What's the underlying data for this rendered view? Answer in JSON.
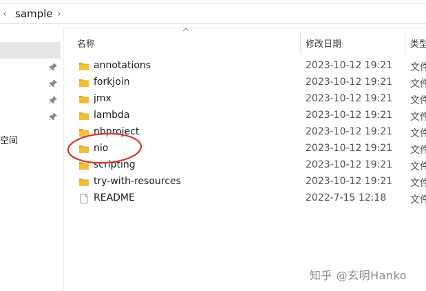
{
  "address_bar": {
    "crumb": "sample",
    "separator_left": "‹",
    "separator_right": "›"
  },
  "nav_pane": {
    "partial_label": "空间",
    "pinned_items": 4
  },
  "columns": {
    "name": "名称",
    "date_modified": "修改日期",
    "type": "类型"
  },
  "files": [
    {
      "name": "annotations",
      "date": "2023-10-12 19:21",
      "type": "文件",
      "kind": "folder"
    },
    {
      "name": "forkjoin",
      "date": "2023-10-12 19:21",
      "type": "文件",
      "kind": "folder"
    },
    {
      "name": "jmx",
      "date": "2023-10-12 19:21",
      "type": "文件",
      "kind": "folder"
    },
    {
      "name": "lambda",
      "date": "2023-10-12 19:21",
      "type": "文件",
      "kind": "folder"
    },
    {
      "name": "nbproject",
      "date": "2023-10-12 19:21",
      "type": "文件",
      "kind": "folder"
    },
    {
      "name": "nio",
      "date": "2023-10-12 19:21",
      "type": "文件",
      "kind": "folder"
    },
    {
      "name": "scripting",
      "date": "2023-10-12 19:21",
      "type": "文件",
      "kind": "folder"
    },
    {
      "name": "try-with-resources",
      "date": "2023-10-12 19:21",
      "type": "文件",
      "kind": "folder"
    },
    {
      "name": "README",
      "date": "2022-7-15 12:18",
      "type": "文件",
      "kind": "file"
    }
  ],
  "annotation": {
    "target": "nio",
    "color": "#d9322a"
  },
  "watermark": "知乎 @玄明Hanko",
  "colors": {
    "folder": "#f2c037",
    "folder_dark": "#e0a520",
    "selection": "#e5e5e5"
  }
}
